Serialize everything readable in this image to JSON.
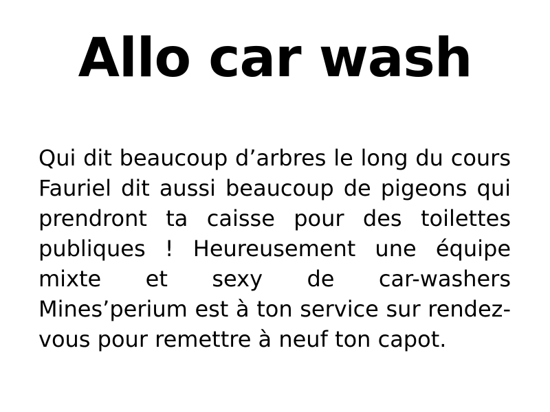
{
  "document": {
    "title": "Allo car wash",
    "paragraph": "Qui dit beaucoup d’arbres le long du cours Fauriel dit aussi beaucoup de pigeons qui prendront ta caisse pour des toilettes publiques ! Heureusement une équipe mixte et sexy de car-washers Mines’perium est à ton service sur rendez-vous pour remettre à neuf ton capot."
  }
}
